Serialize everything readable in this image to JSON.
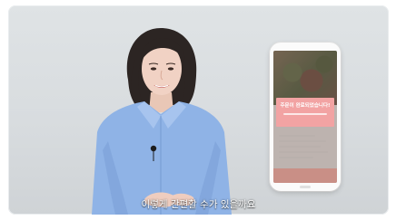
{
  "phone": {
    "modal_title": "주문이 완료되었습니다!"
  },
  "video": {
    "subtitle": "이렇게 간편할 수가 있을까요"
  },
  "colors": {
    "background": "#dfe3e5",
    "shirt": "#8fb3e6",
    "modal": "#f2a3a3"
  }
}
